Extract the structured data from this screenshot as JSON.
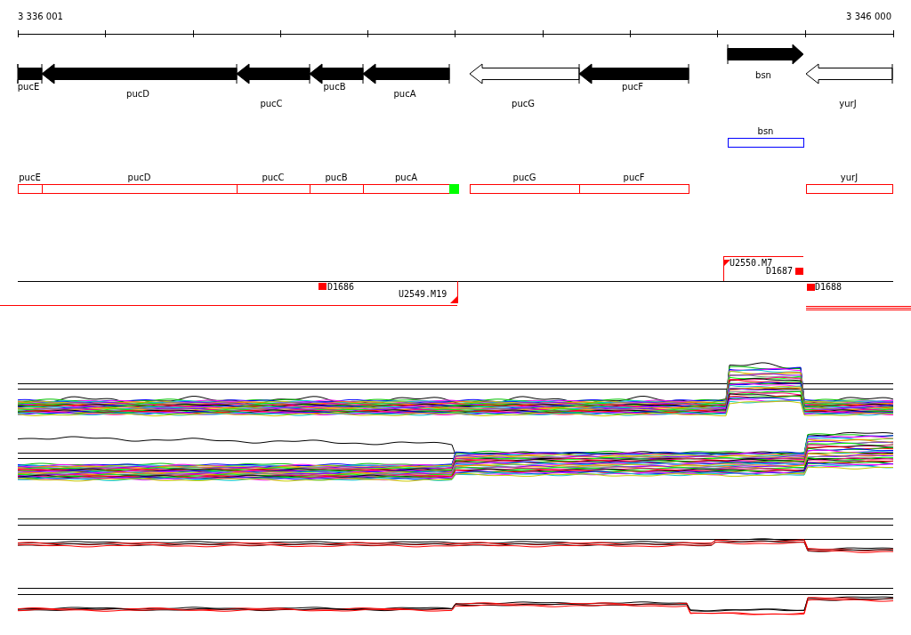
{
  "ruler": {
    "start": "3 336 001",
    "end": "3 346 000"
  },
  "genes": [
    {
      "label": "pucE",
      "kind": "reverse",
      "filled": true
    },
    {
      "label": "pucD",
      "kind": "reverse",
      "filled": true
    },
    {
      "label": "pucC",
      "kind": "reverse",
      "filled": true
    },
    {
      "label": "pucB",
      "kind": "reverse",
      "filled": true
    },
    {
      "label": "pucA",
      "kind": "reverse",
      "filled": true
    },
    {
      "label": "pucG",
      "kind": "reverse",
      "filled": false
    },
    {
      "label": "pucF",
      "kind": "reverse",
      "filled": true
    },
    {
      "label": "bsn",
      "kind": "forward",
      "filled": true
    },
    {
      "label": "yurJ",
      "kind": "reverse",
      "filled": false
    }
  ],
  "annotation_tracks": [
    {
      "features": [
        {
          "label": "bsn",
          "color": "#0000ff"
        }
      ]
    },
    {
      "features": [
        {
          "label": "pucE",
          "color": "#ff0000"
        },
        {
          "label": "pucD",
          "color": "#ff0000"
        },
        {
          "label": "pucC",
          "color": "#ff0000"
        },
        {
          "label": "pucB",
          "color": "#ff0000"
        },
        {
          "label": "pucA",
          "color": "#ff0000"
        },
        {
          "color": "#00ff00"
        },
        {
          "label": "pucG",
          "color": "#ff0000"
        },
        {
          "label": "pucF",
          "color": "#ff0000"
        },
        {
          "label": "yurJ",
          "color": "#ff0000"
        }
      ]
    }
  ],
  "markers": [
    {
      "label": "D1686",
      "kind": "square"
    },
    {
      "label": "U2549.M19",
      "kind": "flag"
    },
    {
      "label": "U2550.M7",
      "kind": "flag"
    },
    {
      "label": "D1687",
      "kind": "square"
    },
    {
      "label": "D1688",
      "kind": "square"
    }
  ]
}
